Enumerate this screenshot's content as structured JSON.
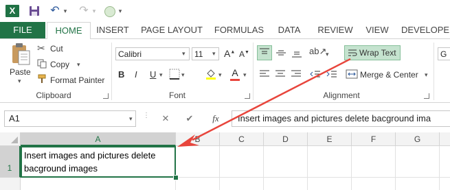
{
  "qat": {
    "app_icon": "X",
    "save_icon": "save-icon",
    "undo_icon": "undo-icon",
    "redo_icon": "redo-icon",
    "customize_icon": "circle-icon"
  },
  "tabs": [
    {
      "label": "FILE"
    },
    {
      "label": "HOME"
    },
    {
      "label": "INSERT"
    },
    {
      "label": "PAGE LAYOUT"
    },
    {
      "label": "FORMULAS"
    },
    {
      "label": "DATA"
    },
    {
      "label": "REVIEW"
    },
    {
      "label": "VIEW"
    },
    {
      "label": "DEVELOPE"
    }
  ],
  "clipboard": {
    "paste_label": "Paste",
    "cut_label": "Cut",
    "copy_label": "Copy",
    "format_painter_label": "Format Painter",
    "group_label": "Clipboard"
  },
  "font": {
    "family": "Calibri",
    "size": "11",
    "bold": "B",
    "italic": "I",
    "underline": "U",
    "font_color_glyph": "A",
    "grow_glyph": "A",
    "shrink_glyph": "A",
    "group_label": "Font"
  },
  "alignment": {
    "wrap_text_label": "Wrap Text",
    "merge_center_label": "Merge & Center",
    "group_label": "Alignment"
  },
  "number": {
    "format_partial": "G"
  },
  "formula_bar": {
    "name_box": "A1",
    "cancel_glyph": "✕",
    "enter_glyph": "✔",
    "fx_label": "fx",
    "content": "Insert images and pictures delete bacground ima"
  },
  "grid": {
    "columns": [
      "A",
      "B",
      "C",
      "D",
      "E",
      "F",
      "G"
    ],
    "row_number": "1",
    "cell_a1": "Insert images and pictures delete bacground images"
  },
  "colors": {
    "accent": "#217346",
    "arrow": "#e8453c",
    "active_button_bg": "#c5e3cf"
  }
}
